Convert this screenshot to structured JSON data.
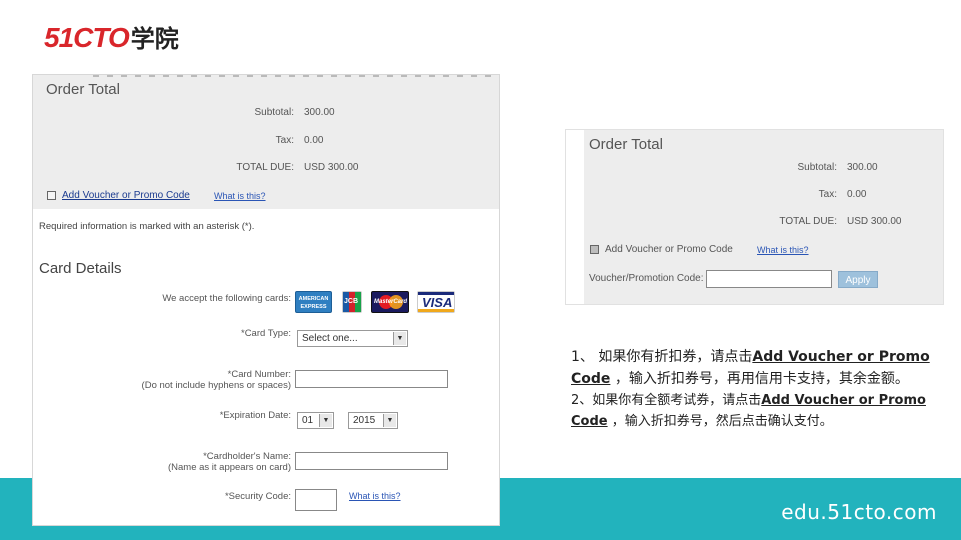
{
  "logo": {
    "num": "51CTO",
    "cn": "学院"
  },
  "footer": {
    "url": "edu.51cto.com"
  },
  "left_form": {
    "order_total": {
      "title": "Order Total",
      "subtotal_label": "Subtotal:",
      "subtotal_value": "300.00",
      "tax_label": "Tax:",
      "tax_value": "0.00",
      "total_label": "TOTAL DUE:",
      "total_value": "USD 300.00",
      "voucher_link": "Add Voucher or Promo Code",
      "what_link": "What is this?"
    },
    "required_note": "Required information is marked with an asterisk (*).",
    "card_details": {
      "title": "Card Details",
      "accept_label": "We accept the following cards:",
      "cards": [
        "AMERICAN EXPRESS",
        "JCB",
        "MasterCard",
        "VISA"
      ],
      "card_type_label": "*Card Type:",
      "card_type_value": "Select one...",
      "card_number_label": "*Card Number:",
      "card_number_hint": "(Do not include hyphens or spaces)",
      "expiration_label": "*Expiration Date:",
      "exp_month": "01",
      "exp_year": "2015",
      "holder_label": "*Cardholder's Name:",
      "holder_hint": "(Name as it appears on card)",
      "security_label": "*Security Code:",
      "security_what": "What is this?"
    }
  },
  "right_form": {
    "title": "Order Total",
    "subtotal_label": "Subtotal:",
    "subtotal_value": "300.00",
    "tax_label": "Tax:",
    "tax_value": "0.00",
    "total_label": "TOTAL DUE:",
    "total_value": "USD 300.00",
    "voucher_label": "Add Voucher or Promo Code",
    "what_link": "What is this?",
    "promo_label": "Voucher/Promotion Code:",
    "apply_label": "Apply"
  },
  "instructions": {
    "p1_prefix": "1、 如果你有折扣券，请点击",
    "p1_link": "Add Voucher or Promo Code",
    "p1_suffix": " ，输入折扣券号，再用信用卡支持，其余金额。",
    "p2_prefix": "2、如果你有全额考试券，请点击",
    "p2_link": "Add Voucher or Promo Code",
    "p2_suffix": " ，输入折扣券号，然后点击确认支付。"
  },
  "colors": {
    "accent": "#22b3bd",
    "brand_red": "#d9262b",
    "link": "#1a3a8f"
  }
}
